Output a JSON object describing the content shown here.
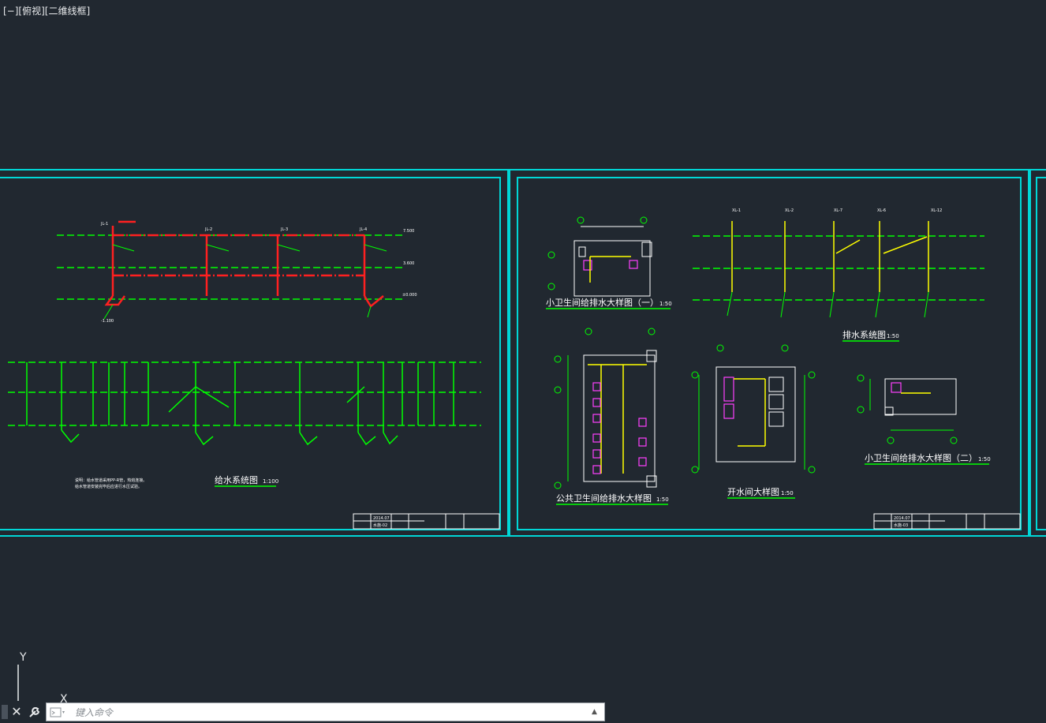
{
  "viewport": {
    "label": "[−][俯视][二维线框]"
  },
  "colors": {
    "background": "#212830",
    "frame": "#00d7d7",
    "green": "#00ff00",
    "yellow": "#ffff00",
    "red": "#ff2020",
    "magenta": "#ff40ff",
    "white": "#ffffff"
  },
  "sheets": [
    {
      "titles": [
        {
          "text": "给水系统图",
          "scale": "1:100"
        }
      ],
      "title_block": {
        "date": "2014.07",
        "code": "水施-02"
      }
    },
    {
      "titles": [
        {
          "text": "小卫生间给排水大样图（一）",
          "scale": "1:50"
        },
        {
          "text": "排水系统图",
          "scale": "1:50"
        },
        {
          "text": "公共卫生间给排水大样图",
          "scale": "1:50"
        },
        {
          "text": "开水间大样图",
          "scale": "1:50"
        },
        {
          "text": "小卫生间给排水大样图（二）",
          "scale": "1:50"
        }
      ],
      "title_block": {
        "date": "2014.07",
        "code": "水施-03"
      }
    }
  ],
  "labels": {
    "supply_risers": [
      "JL-1",
      "JL-2",
      "JL-3",
      "JL-4"
    ],
    "drain_risers": [
      "XL-1",
      "XL-2",
      "XL-7",
      "XL-6",
      "XL-12"
    ],
    "levels": [
      "7.500",
      "3.600",
      "±0.000",
      "-1.100"
    ],
    "grid_axes": [
      "3",
      "4",
      "F",
      "E",
      "D",
      "J1",
      "J4",
      "B",
      "A",
      "1",
      "2"
    ]
  },
  "ucs": {
    "y_label": "Y",
    "x_label": "X"
  },
  "command_line": {
    "placeholder": "键入命令",
    "close_icon": "close-icon",
    "tools_icon": "wrench-icon",
    "prompt_icon": "command-prompt-icon",
    "history_icon": "triangle-up-icon"
  }
}
